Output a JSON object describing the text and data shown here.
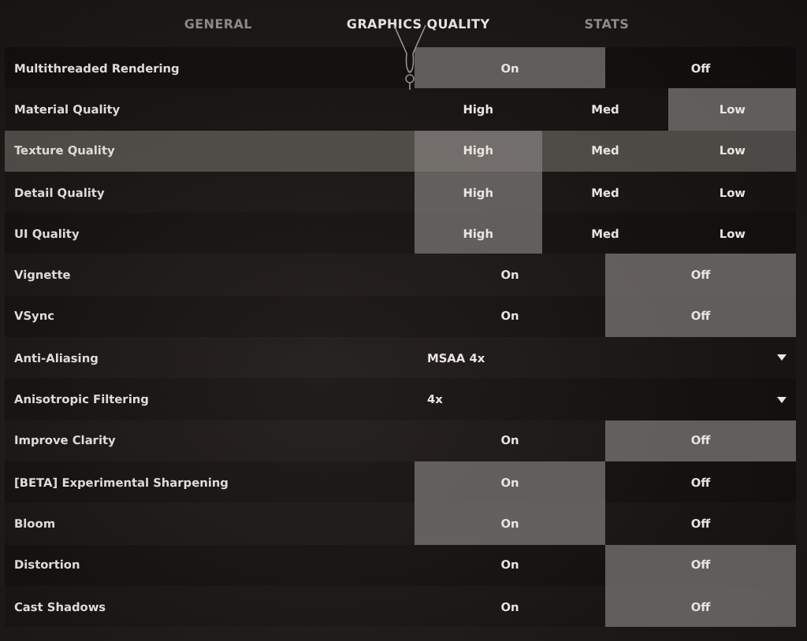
{
  "tabs": [
    {
      "label": "GENERAL",
      "selected": false
    },
    {
      "label": "GRAPHICS QUALITY",
      "selected": true
    },
    {
      "label": "STATS",
      "selected": false
    }
  ],
  "settings": [
    {
      "kind": "choice",
      "label": "Multithreaded Rendering",
      "hovered": false,
      "options": [
        {
          "label": "On",
          "selected": true
        },
        {
          "label": "Off",
          "selected": false
        }
      ]
    },
    {
      "kind": "choice",
      "label": "Material Quality",
      "hovered": false,
      "options": [
        {
          "label": "High",
          "selected": false
        },
        {
          "label": "Med",
          "selected": false
        },
        {
          "label": "Low",
          "selected": true
        }
      ]
    },
    {
      "kind": "choice",
      "label": "Texture Quality",
      "hovered": true,
      "options": [
        {
          "label": "High",
          "selected": true
        },
        {
          "label": "Med",
          "selected": false
        },
        {
          "label": "Low",
          "selected": false
        }
      ]
    },
    {
      "kind": "choice",
      "label": "Detail Quality",
      "hovered": false,
      "options": [
        {
          "label": "High",
          "selected": true
        },
        {
          "label": "Med",
          "selected": false
        },
        {
          "label": "Low",
          "selected": false
        }
      ]
    },
    {
      "kind": "choice",
      "label": "UI Quality",
      "hovered": false,
      "options": [
        {
          "label": "High",
          "selected": true
        },
        {
          "label": "Med",
          "selected": false
        },
        {
          "label": "Low",
          "selected": false
        }
      ]
    },
    {
      "kind": "choice",
      "label": "Vignette",
      "hovered": false,
      "options": [
        {
          "label": "On",
          "selected": false
        },
        {
          "label": "Off",
          "selected": true
        }
      ]
    },
    {
      "kind": "choice",
      "label": "VSync",
      "hovered": false,
      "options": [
        {
          "label": "On",
          "selected": false
        },
        {
          "label": "Off",
          "selected": true
        }
      ]
    },
    {
      "kind": "dropdown",
      "label": "Anti-Aliasing",
      "hovered": false,
      "value": "MSAA 4x"
    },
    {
      "kind": "dropdown",
      "label": "Anisotropic Filtering",
      "hovered": false,
      "value": "4x"
    },
    {
      "kind": "choice",
      "label": "Improve Clarity",
      "hovered": false,
      "options": [
        {
          "label": "On",
          "selected": false
        },
        {
          "label": "Off",
          "selected": true
        }
      ]
    },
    {
      "kind": "choice",
      "label": "[BETA] Experimental Sharpening",
      "hovered": false,
      "options": [
        {
          "label": "On",
          "selected": true
        },
        {
          "label": "Off",
          "selected": false
        }
      ]
    },
    {
      "kind": "choice",
      "label": "Bloom",
      "hovered": false,
      "options": [
        {
          "label": "On",
          "selected": true
        },
        {
          "label": "Off",
          "selected": false
        }
      ]
    },
    {
      "kind": "choice",
      "label": "Distortion",
      "hovered": false,
      "options": [
        {
          "label": "On",
          "selected": false
        },
        {
          "label": "Off",
          "selected": true
        }
      ]
    },
    {
      "kind": "choice",
      "label": "Cast Shadows",
      "hovered": false,
      "options": [
        {
          "label": "On",
          "selected": false
        },
        {
          "label": "Off",
          "selected": true
        }
      ]
    }
  ]
}
